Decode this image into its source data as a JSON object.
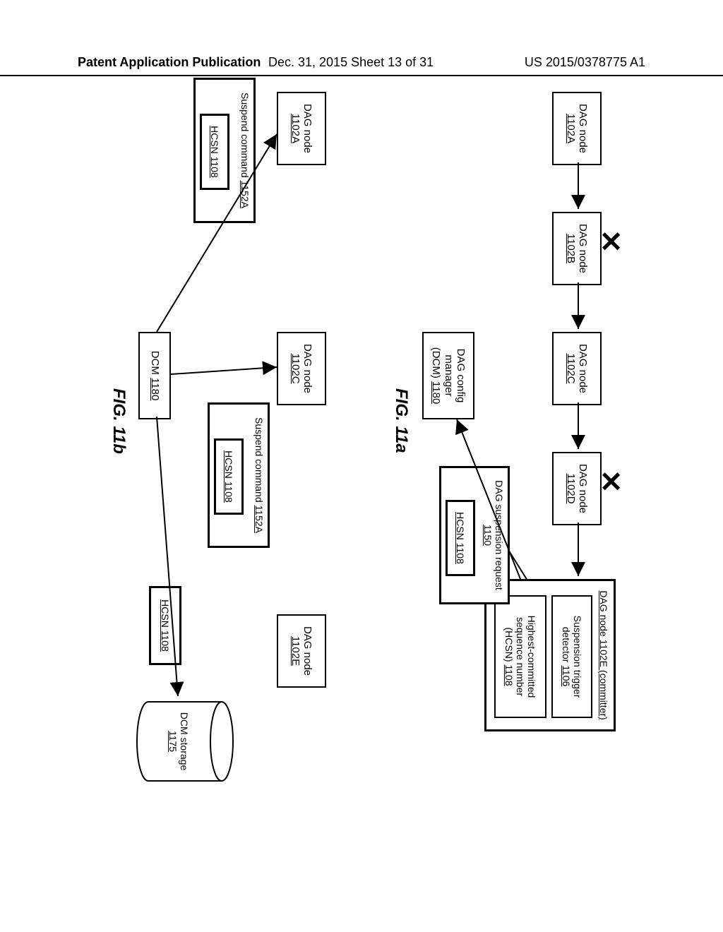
{
  "header": {
    "left": "Patent Application Publication",
    "center": "Dec. 31, 2015  Sheet 13 of 31",
    "right": "US 2015/0378775 A1"
  },
  "figA": {
    "label": "FIG. 11a",
    "nodeA": {
      "l1": "DAG node",
      "l2": "1102A"
    },
    "nodeB": {
      "l1": "DAG node",
      "l2": "1102B"
    },
    "nodeC": {
      "l1": "DAG node",
      "l2": "1102C"
    },
    "nodeD": {
      "l1": "DAG node",
      "l2": "1102D"
    },
    "committer": {
      "title": "DAG node 1102E (committer)",
      "detector": {
        "l1": "Suspension trigger",
        "l2": "detector 1106"
      },
      "hcsn": {
        "l1": "Highest-committed",
        "l2": "sequence number",
        "l3": "(HCSN) 1108"
      }
    },
    "dcm": {
      "l1": "DAG config",
      "l2": "manager",
      "l3": "(DCM) 1180"
    },
    "susreq": {
      "l1": "DAG suspension request",
      "l2": "1150",
      "hcsn": "HCSN 1108"
    }
  },
  "figB": {
    "label": "FIG. 11b",
    "nA": {
      "l1": "DAG node",
      "l2": "1102A"
    },
    "nC": {
      "l1": "DAG node",
      "l2": "1102C"
    },
    "nE": {
      "l1": "DAG node",
      "l2": "1102E"
    },
    "dcm": "DCM 1180",
    "cylTop": "DCM storage",
    "cylId": "1175",
    "cmdLeft": {
      "title": "Suspend command 1152A",
      "hcsn": "HCSN 1108"
    },
    "cmdRight": {
      "title": "Suspend command 1152A",
      "hcsn": "HCSN 1108"
    },
    "hcsnBox": "HCSN 1108"
  }
}
